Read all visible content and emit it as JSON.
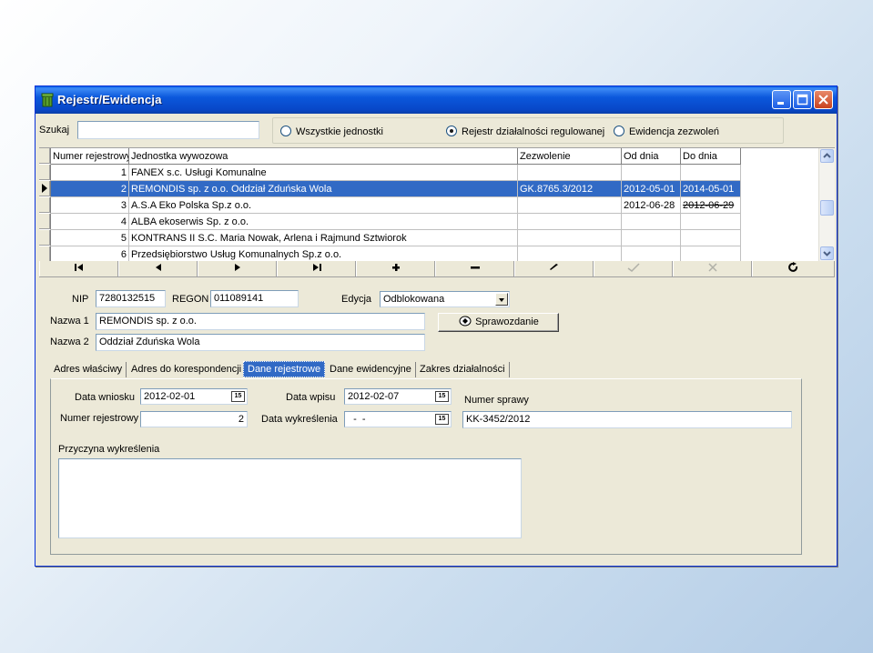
{
  "window": {
    "title": "Rejestr/Ewidencja"
  },
  "search": {
    "label": "Szukaj",
    "value": ""
  },
  "filters": [
    {
      "label": "Wszystkie jednostki",
      "selected": false
    },
    {
      "label": "Rejestr działalności regulowanej",
      "selected": true
    },
    {
      "label": "Ewidencja zezwoleń",
      "selected": false
    }
  ],
  "grid": {
    "columns": [
      "Numer rejestrowy",
      "Jednostka wywozowa",
      "Zezwolenie",
      "Od dnia",
      "Do dnia"
    ],
    "rows": [
      {
        "num": "1",
        "name": "FANEX s.c. Usługi Komunalne",
        "permit": "",
        "from": "",
        "to": ""
      },
      {
        "num": "2",
        "name": "REMONDIS sp. z o.o. Oddział Zduńska Wola",
        "permit": "GK.8765.3/2012",
        "from": "2012-05-01",
        "to": "2014-05-01"
      },
      {
        "num": "3",
        "name": "A.S.A Eko Polska Sp.z o.o.",
        "permit": "",
        "from": "2012-06-28",
        "to": "2012-06-29"
      },
      {
        "num": "4",
        "name": "ALBA ekoserwis Sp. z o.o.",
        "permit": "",
        "from": "",
        "to": ""
      },
      {
        "num": "5",
        "name": "KONTRANS II S.C. Maria Nowak, Arlena i Rajmund Sztwiorok",
        "permit": "",
        "from": "",
        "to": ""
      },
      {
        "num": "6",
        "name": "Przedsiębiorstwo Usług Komunalnych Sp.z o.o.",
        "permit": "",
        "from": "",
        "to": ""
      }
    ],
    "selected_row": 1
  },
  "nav_icons": [
    "first-icon",
    "prior-icon",
    "next-icon",
    "last-icon",
    "insert-icon",
    "delete-icon",
    "edit-icon",
    "post-icon",
    "cancel-icon",
    "refresh-icon"
  ],
  "form": {
    "nip_label": "NIP",
    "nip": "7280132515",
    "regon_label": "REGON",
    "regon": "011089141",
    "edycja_label": "Edycja",
    "edycja": "Odblokowana",
    "nazwa1_label": "Nazwa 1",
    "nazwa1": "REMONDIS sp. z o.o.",
    "nazwa2_label": "Nazwa 2",
    "nazwa2": "Oddział Zduńska Wola",
    "report_button": "Sprawozdanie"
  },
  "tabs": [
    "Adres właściwy",
    "Adres do korespondencji",
    "Dane rejestrowe",
    "Dane ewidencyjne",
    "Zakres działalności"
  ],
  "tab_active": 2,
  "tab_content": {
    "data_wniosku_label": "Data wniosku",
    "data_wniosku": "2012-02-01",
    "data_wpisu_label": "Data wpisu",
    "data_wpisu": "2012-02-07",
    "numer_sprawy_label": "Numer sprawy",
    "numer_sprawy": "KK-3452/2012",
    "numer_rejestrowy_label": "Numer rejestrowy",
    "numer_rejestrowy": "2",
    "data_wykreslenia_label": "Data wykreślenia",
    "data_wykreslenia": "  -  -",
    "przyczyna_label": "Przyczyna wykreślenia",
    "przyczyna": "",
    "calendar_glyph": "15"
  }
}
